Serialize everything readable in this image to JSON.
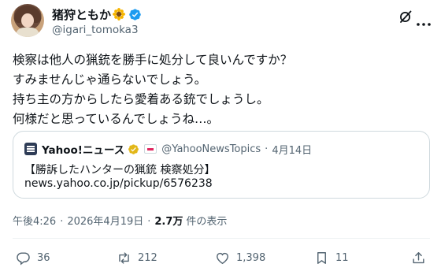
{
  "author": {
    "display_name": "猪狩ともか",
    "handle": "@igari_tomoka3",
    "verified": true,
    "name_emoji": "sunflower-icon"
  },
  "tweet": {
    "lines": [
      "検察は他人の猟銃を勝手に処分して良いんですか？",
      "すみませんじゃ通らないでしょう。",
      "持ち主の方からしたら愛着ある銃でしょうし。",
      "何様だと思っているんでしょうね…。"
    ]
  },
  "quote": {
    "source_name": "Yahoo!ニュース",
    "handle": "@YahooNewsTopics",
    "separator": "·",
    "date": "4月14日",
    "title": "【勝訴したハンターの猟銃 検察処分】",
    "link": "news.yahoo.co.jp/pickup/6576238"
  },
  "meta": {
    "time": "午後4:26",
    "separator": "·",
    "date": "2026年4月19日",
    "views_count": "2.7万",
    "views_label": "件の表示"
  },
  "actions": {
    "replies": "36",
    "reposts": "212",
    "likes": "1,398",
    "bookmarks": "11"
  },
  "colors": {
    "text": "#0f1419",
    "secondary": "#536471",
    "verified_blue": "#1d9bf0",
    "verified_gold": "#e2b719",
    "border": "#cfd9de"
  }
}
